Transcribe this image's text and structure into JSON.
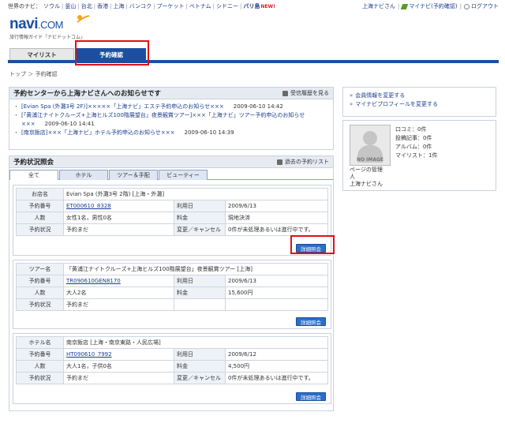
{
  "topnav": {
    "label": "世界のナビ：",
    "cities": [
      "ソウル",
      "釜山",
      "台北",
      "香港",
      "上海",
      "バンコク",
      "プーケット",
      "ベトナム",
      "シドニー",
      "バリ島"
    ],
    "new_badge": "NEW!"
  },
  "toplinks": {
    "user": "上海ナビさん",
    "mynavi": "マイナビ(予約確認)",
    "logout": "ログアウト"
  },
  "logo": {
    "name": "navi",
    "domain": ".COM",
    "tagline": "旅行情報ガイド「ナビドットコム」"
  },
  "tabs": {
    "mylist": "マイリスト",
    "reservation": "予約確認"
  },
  "breadcrumb": "トップ ＞ 予約確認",
  "notice": {
    "title": "予約センターから上海ナビさんへのお知らせです",
    "history_link": "受信履歴を見る",
    "items": [
      {
        "text": "[Evian Spa (外灘3号 2F)]×××××「上海ナビ」エステ予約申込のお知らせ×××",
        "date": "2009-06-10 14:42"
      },
      {
        "text": "[「黄浦江ナイトクルーズ+上海ヒルズ100階展望台」夜景観賞ツアー]×××「上海ナビ」ツアー予約申込のお知らせ×××",
        "date": "2009-06-10 14:41"
      },
      {
        "text": "[南京飯店]×××「上海ナビ」ホテル予約申込のお知らせ×××",
        "date": "2009-06-10 14:39"
      }
    ]
  },
  "status": {
    "title": "予約状況照会",
    "past_link": "過去の予約リスト",
    "filters": [
      "全て",
      "ホテル",
      "ツアー＆手配",
      "ビューティー"
    ],
    "detail_label": "詳細照会",
    "bookings": [
      {
        "name_label": "お店名",
        "name": "Evian Spa (外灘3号 2階) [上海・外灘]",
        "number_label": "予約番号",
        "number": "ET000610_8328",
        "date_label": "利用日",
        "date": "2009/6/13",
        "people_label": "人数",
        "people": "女性1名，男性0名",
        "fee_label": "料金",
        "fee": "現地決済",
        "state_label": "予約状況",
        "state": "予約まだ",
        "cancel_label": "変更／キャンセル",
        "cancel": "0件が未処理あるいは進行中です。"
      },
      {
        "name_label": "ツアー名",
        "name": "「黄浦江ナイトクルーズ+上海ヒルズ100階展望台」夜景観賞ツアー [上海]",
        "number_label": "予約番号",
        "number": "TR090610GEN8170",
        "date_label": "利用日",
        "date": "2009/6/13",
        "people_label": "人数",
        "people": "大人2名",
        "fee_label": "料金",
        "fee": "15,600円",
        "state_label": "予約状況",
        "state": "予約まだ"
      },
      {
        "name_label": "ホテル名",
        "name": "南京飯店 [上海・南京東路・人民広場]",
        "number_label": "予約番号",
        "number": "HT090610_7992",
        "date_label": "利用日",
        "date": "2009/6/12",
        "people_label": "人数",
        "people": "大人1名，子供0名",
        "fee_label": "料金",
        "fee": "4,500円",
        "state_label": "予約状況",
        "state": "予約まだ",
        "cancel_label": "変更／キャンセル",
        "cancel": "0件が未処理あるいは進行中です。"
      }
    ]
  },
  "account": {
    "edit_member": "会員情報を変更する",
    "edit_profile": "マイナビプロフィールを変更する"
  },
  "profile": {
    "no_image": "NO IMAGE",
    "stats": [
      "口コミ：0件",
      "投稿記事：0件",
      "アルバム：0件",
      "マイリスト：1件"
    ],
    "manager_line1": "ページの管理",
    "manager_line2": "人",
    "manager_name": "上海ナビさん"
  },
  "colors": {
    "brand_blue": "#1c4fa1",
    "highlight_red": "#e0101a",
    "button_blue": "#2d6dc7"
  }
}
